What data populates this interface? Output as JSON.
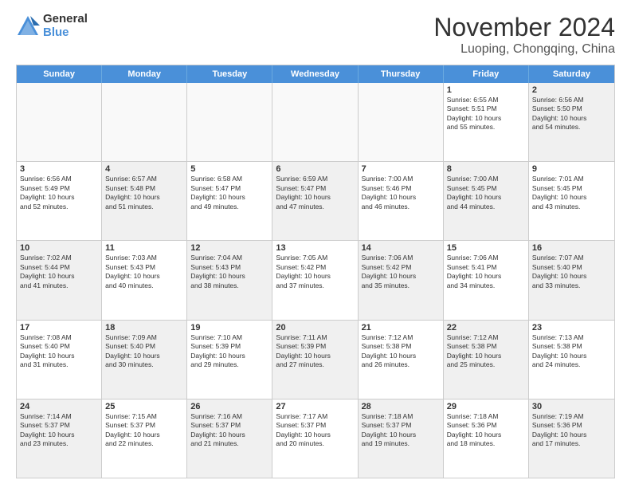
{
  "logo": {
    "general": "General",
    "blue": "Blue"
  },
  "title": "November 2024",
  "subtitle": "Luoping, Chongqing, China",
  "header_days": [
    "Sunday",
    "Monday",
    "Tuesday",
    "Wednesday",
    "Thursday",
    "Friday",
    "Saturday"
  ],
  "weeks": [
    [
      {
        "day": "",
        "text": "",
        "empty": true
      },
      {
        "day": "",
        "text": "",
        "empty": true
      },
      {
        "day": "",
        "text": "",
        "empty": true
      },
      {
        "day": "",
        "text": "",
        "empty": true
      },
      {
        "day": "",
        "text": "",
        "empty": true
      },
      {
        "day": "1",
        "text": "Sunrise: 6:55 AM\nSunset: 5:51 PM\nDaylight: 10 hours\nand 55 minutes.",
        "empty": false
      },
      {
        "day": "2",
        "text": "Sunrise: 6:56 AM\nSunset: 5:50 PM\nDaylight: 10 hours\nand 54 minutes.",
        "empty": false,
        "shaded": true
      }
    ],
    [
      {
        "day": "3",
        "text": "Sunrise: 6:56 AM\nSunset: 5:49 PM\nDaylight: 10 hours\nand 52 minutes.",
        "empty": false
      },
      {
        "day": "4",
        "text": "Sunrise: 6:57 AM\nSunset: 5:48 PM\nDaylight: 10 hours\nand 51 minutes.",
        "empty": false,
        "shaded": true
      },
      {
        "day": "5",
        "text": "Sunrise: 6:58 AM\nSunset: 5:47 PM\nDaylight: 10 hours\nand 49 minutes.",
        "empty": false
      },
      {
        "day": "6",
        "text": "Sunrise: 6:59 AM\nSunset: 5:47 PM\nDaylight: 10 hours\nand 47 minutes.",
        "empty": false,
        "shaded": true
      },
      {
        "day": "7",
        "text": "Sunrise: 7:00 AM\nSunset: 5:46 PM\nDaylight: 10 hours\nand 46 minutes.",
        "empty": false
      },
      {
        "day": "8",
        "text": "Sunrise: 7:00 AM\nSunset: 5:45 PM\nDaylight: 10 hours\nand 44 minutes.",
        "empty": false,
        "shaded": true
      },
      {
        "day": "9",
        "text": "Sunrise: 7:01 AM\nSunset: 5:45 PM\nDaylight: 10 hours\nand 43 minutes.",
        "empty": false
      }
    ],
    [
      {
        "day": "10",
        "text": "Sunrise: 7:02 AM\nSunset: 5:44 PM\nDaylight: 10 hours\nand 41 minutes.",
        "empty": false,
        "shaded": true
      },
      {
        "day": "11",
        "text": "Sunrise: 7:03 AM\nSunset: 5:43 PM\nDaylight: 10 hours\nand 40 minutes.",
        "empty": false
      },
      {
        "day": "12",
        "text": "Sunrise: 7:04 AM\nSunset: 5:43 PM\nDaylight: 10 hours\nand 38 minutes.",
        "empty": false,
        "shaded": true
      },
      {
        "day": "13",
        "text": "Sunrise: 7:05 AM\nSunset: 5:42 PM\nDaylight: 10 hours\nand 37 minutes.",
        "empty": false
      },
      {
        "day": "14",
        "text": "Sunrise: 7:06 AM\nSunset: 5:42 PM\nDaylight: 10 hours\nand 35 minutes.",
        "empty": false,
        "shaded": true
      },
      {
        "day": "15",
        "text": "Sunrise: 7:06 AM\nSunset: 5:41 PM\nDaylight: 10 hours\nand 34 minutes.",
        "empty": false
      },
      {
        "day": "16",
        "text": "Sunrise: 7:07 AM\nSunset: 5:40 PM\nDaylight: 10 hours\nand 33 minutes.",
        "empty": false,
        "shaded": true
      }
    ],
    [
      {
        "day": "17",
        "text": "Sunrise: 7:08 AM\nSunset: 5:40 PM\nDaylight: 10 hours\nand 31 minutes.",
        "empty": false
      },
      {
        "day": "18",
        "text": "Sunrise: 7:09 AM\nSunset: 5:40 PM\nDaylight: 10 hours\nand 30 minutes.",
        "empty": false,
        "shaded": true
      },
      {
        "day": "19",
        "text": "Sunrise: 7:10 AM\nSunset: 5:39 PM\nDaylight: 10 hours\nand 29 minutes.",
        "empty": false
      },
      {
        "day": "20",
        "text": "Sunrise: 7:11 AM\nSunset: 5:39 PM\nDaylight: 10 hours\nand 27 minutes.",
        "empty": false,
        "shaded": true
      },
      {
        "day": "21",
        "text": "Sunrise: 7:12 AM\nSunset: 5:38 PM\nDaylight: 10 hours\nand 26 minutes.",
        "empty": false
      },
      {
        "day": "22",
        "text": "Sunrise: 7:12 AM\nSunset: 5:38 PM\nDaylight: 10 hours\nand 25 minutes.",
        "empty": false,
        "shaded": true
      },
      {
        "day": "23",
        "text": "Sunrise: 7:13 AM\nSunset: 5:38 PM\nDaylight: 10 hours\nand 24 minutes.",
        "empty": false
      }
    ],
    [
      {
        "day": "24",
        "text": "Sunrise: 7:14 AM\nSunset: 5:37 PM\nDaylight: 10 hours\nand 23 minutes.",
        "empty": false,
        "shaded": true
      },
      {
        "day": "25",
        "text": "Sunrise: 7:15 AM\nSunset: 5:37 PM\nDaylight: 10 hours\nand 22 minutes.",
        "empty": false
      },
      {
        "day": "26",
        "text": "Sunrise: 7:16 AM\nSunset: 5:37 PM\nDaylight: 10 hours\nand 21 minutes.",
        "empty": false,
        "shaded": true
      },
      {
        "day": "27",
        "text": "Sunrise: 7:17 AM\nSunset: 5:37 PM\nDaylight: 10 hours\nand 20 minutes.",
        "empty": false
      },
      {
        "day": "28",
        "text": "Sunrise: 7:18 AM\nSunset: 5:37 PM\nDaylight: 10 hours\nand 19 minutes.",
        "empty": false,
        "shaded": true
      },
      {
        "day": "29",
        "text": "Sunrise: 7:18 AM\nSunset: 5:36 PM\nDaylight: 10 hours\nand 18 minutes.",
        "empty": false
      },
      {
        "day": "30",
        "text": "Sunrise: 7:19 AM\nSunset: 5:36 PM\nDaylight: 10 hours\nand 17 minutes.",
        "empty": false,
        "shaded": true
      }
    ]
  ]
}
